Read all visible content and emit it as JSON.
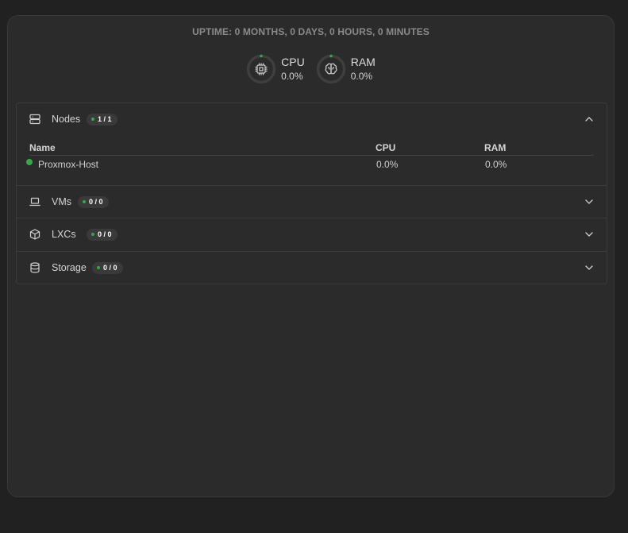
{
  "uptime": "UPTIME: 0 MONTHS, 0 DAYS, 0 HOURS, 0 MINUTES",
  "gauges": {
    "cpu": {
      "label": "CPU",
      "value": "0.0%",
      "icon": "cpu-chip-icon",
      "level": 0
    },
    "ram": {
      "label": "RAM",
      "value": "0.0%",
      "icon": "brain-icon",
      "level": 0
    }
  },
  "sections": {
    "nodes": {
      "title": "Nodes",
      "badge": "1 / 1",
      "icon": "server-icon",
      "expanded": true,
      "columns": {
        "name": "Name",
        "cpu": "CPU",
        "ram": "RAM"
      },
      "rows": [
        {
          "name": "Proxmox-Host",
          "cpu": "0.0%",
          "ram": "0.0%",
          "status": "online"
        }
      ]
    },
    "vms": {
      "title": "VMs",
      "badge": "0 / 0",
      "icon": "laptop-icon",
      "expanded": false
    },
    "lxcs": {
      "title": "LXCs",
      "badge": "0 / 0",
      "icon": "box-icon",
      "expanded": false
    },
    "storage": {
      "title": "Storage",
      "badge": "0 / 0",
      "icon": "database-icon",
      "expanded": false
    }
  },
  "colors": {
    "accent_green": "#35a84a",
    "card_bg": "#2b2b2b",
    "page_bg": "#212121"
  }
}
